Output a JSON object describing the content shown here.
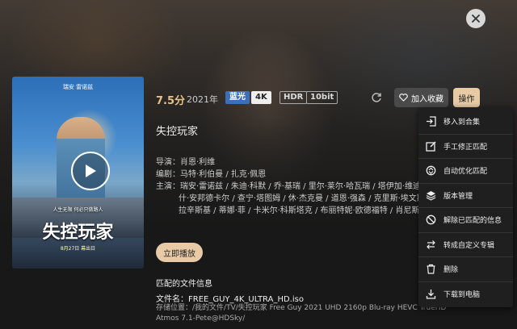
{
  "movie": {
    "rating": "7.5分",
    "year": "2021年",
    "badges": {
      "bluray": "蓝光",
      "k4": "4K",
      "hdr": "HDR",
      "bit": "10bit"
    },
    "title": "失控玩家",
    "director_line": "导演：肖恩·利维",
    "writer_line": "编剧：马特·利伯曼 / 扎克·佩恩",
    "cast_line1": "主演：瑞安·雷诺兹 / 朱迪·科默 / 乔·基瑞 / 里尔·莱尔·哈瓦瑞 / 塔伊加·维迪提",
    "cast_line2": "什·安邦德卡尔 / 查宁·塔图姆 / 休·杰克曼 / 道恩·强森 / 克里斯·埃文斯",
    "cast_line3": "拉辛斯基 / 蒂娜·菲 / 卡米尔·科斯塔克 / 布丽特妮·欧德福特 / 肖尼斯·"
  },
  "poster": {
    "top_cast": "瑞安 雷诺兹",
    "tagline": "人生无限 何必只做路人",
    "title": "失控玩家",
    "release": "8月27日 幕出日"
  },
  "actions": {
    "favorite_label": "加入收藏",
    "operation_label": "操作",
    "play_now_label": "立即播放"
  },
  "files": {
    "heading": "匹配的文件信息",
    "file_name": "文件名：FREE_GUY_4K_ULTRA_HD.iso",
    "file_path": "存储位置：/我的文件/TV/失控玩家 Free Guy 2021 UHD 2160p Blu-ray HEVC TrueHD Atmos 7.1-Pete@HDSky/"
  },
  "menu": {
    "items": [
      {
        "label": "移入到合集",
        "icon": "move-in-icon"
      },
      {
        "label": "手工修正匹配",
        "icon": "edit-icon"
      },
      {
        "label": "自动优化匹配",
        "icon": "sync-icon"
      },
      {
        "label": "版本管理",
        "icon": "layers-icon"
      },
      {
        "label": "解除已匹配的信息",
        "icon": "block-icon"
      },
      {
        "label": "转成自定义专辑",
        "icon": "convert-icon"
      },
      {
        "label": "删除",
        "icon": "trash-icon"
      },
      {
        "label": "下载到电脑",
        "icon": "download-icon"
      }
    ]
  },
  "colors": {
    "accent": "#e8caa6",
    "badge_blue": "#3b6fb8",
    "rating": "#e8c28a"
  }
}
